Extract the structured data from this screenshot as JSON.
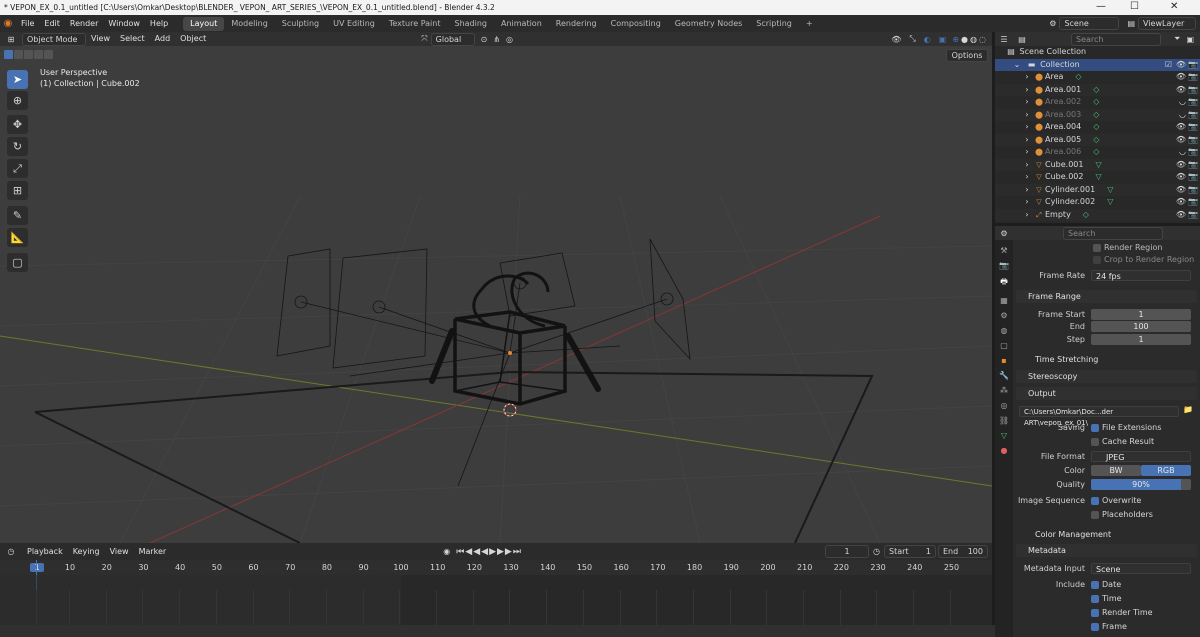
{
  "window": {
    "title": "* VEPON_EX_0.1_untitled [C:\\Users\\Omkar\\Desktop\\BLENDER_ VEPON_ ART_SERIES_\\VEPON_EX_0.1_untitled.blend] - Blender 4.3.2",
    "minimize": "—",
    "maximize": "☐",
    "close": "✕"
  },
  "menu": [
    "File",
    "Edit",
    "Render",
    "Window",
    "Help"
  ],
  "workspaces": [
    "Layout",
    "Modeling",
    "Sculpting",
    "UV Editing",
    "Texture Paint",
    "Shading",
    "Animation",
    "Rendering",
    "Compositing",
    "Geometry Nodes",
    "Scripting"
  ],
  "workspace_add": "+",
  "scene": {
    "name": "Scene",
    "view_layer": "ViewLayer"
  },
  "viewport_header": {
    "mode": "Object Mode",
    "menus": [
      "View",
      "Select",
      "Add",
      "Object"
    ],
    "orientation": "Global",
    "options": "Options"
  },
  "viewport": {
    "perspective": "User Perspective",
    "context": "(1) Collection | Cube.002",
    "colors": {
      "bg": "#3d3d3d",
      "grid": "#4a4a4a",
      "x_axis": "#9a3b3b",
      "y_axis": "#7a8a2e",
      "wire": "#141414"
    }
  },
  "toolbar_icons": [
    "select-box-icon",
    "cursor-icon",
    "move-icon",
    "rotate-icon",
    "scale-icon",
    "transform-icon",
    "annotate-icon",
    "measure-icon",
    "add-cube-icon"
  ],
  "outliner": {
    "search_placeholder": "Search",
    "scene_collection": "Scene Collection",
    "collection": "Collection",
    "items": [
      {
        "name": "Area",
        "type": "light",
        "visible": true
      },
      {
        "name": "Area.001",
        "type": "light",
        "visible": true
      },
      {
        "name": "Area.002",
        "type": "light",
        "visible": false
      },
      {
        "name": "Area.003",
        "type": "light",
        "visible": false
      },
      {
        "name": "Area.004",
        "type": "light",
        "visible": true
      },
      {
        "name": "Area.005",
        "type": "light",
        "visible": true
      },
      {
        "name": "Area.006",
        "type": "light",
        "visible": false
      },
      {
        "name": "Cube.001",
        "type": "mesh",
        "visible": true
      },
      {
        "name": "Cube.002",
        "type": "mesh",
        "visible": true
      },
      {
        "name": "Cylinder.001",
        "type": "mesh",
        "visible": true
      },
      {
        "name": "Cylinder.002",
        "type": "mesh",
        "visible": true
      },
      {
        "name": "Empty",
        "type": "empty",
        "visible": true
      }
    ]
  },
  "properties": {
    "search_placeholder": "Search",
    "render_region": "Render Region",
    "crop_to_render_region": "Crop to Render Region",
    "frame_rate_label": "Frame Rate",
    "frame_rate": "24 fps",
    "frame_range": "Frame Range",
    "frame_start_label": "Frame Start",
    "frame_start": "1",
    "end_label": "End",
    "end": "100",
    "step_label": "Step",
    "step": "1",
    "time_stretching": "Time Stretching",
    "stereoscopy": "Stereoscopy",
    "output": "Output",
    "output_path": "C:\\Users\\Omkar\\Doc...der ART\\vepon_ex_01\\",
    "saving_label": "Saving",
    "file_extensions": "File Extensions",
    "cache_result": "Cache Result",
    "file_format_label": "File Format",
    "file_format": "JPEG",
    "color_label": "Color",
    "color_bw": "BW",
    "color_rgb": "RGB",
    "quality_label": "Quality",
    "quality": "90%",
    "quality_value": 0.9,
    "image_sequence_label": "Image Sequence",
    "overwrite": "Overwrite",
    "placeholders": "Placeholders",
    "color_management": "Color Management",
    "metadata": "Metadata",
    "metadata_input_label": "Metadata Input",
    "metadata_input": "Scene",
    "include_label": "Include",
    "include_date": "Date",
    "include_time": "Time",
    "include_render_time": "Render Time",
    "include_frame": "Frame"
  },
  "timeline": {
    "menus": [
      "Playback",
      "Keying",
      "View",
      "Marker"
    ],
    "current_frame": "1",
    "start_label": "Start",
    "start": "1",
    "end_label": "End",
    "end": "100",
    "ruler": [
      "1",
      "10",
      "20",
      "30",
      "40",
      "50",
      "60",
      "70",
      "80",
      "90",
      "100",
      "110",
      "120",
      "130",
      "140",
      "150",
      "160",
      "170",
      "180",
      "190",
      "200",
      "210",
      "220",
      "230",
      "240",
      "250"
    ],
    "colors": {
      "playhead": "#4772b3"
    }
  },
  "accent": "#4772b3"
}
